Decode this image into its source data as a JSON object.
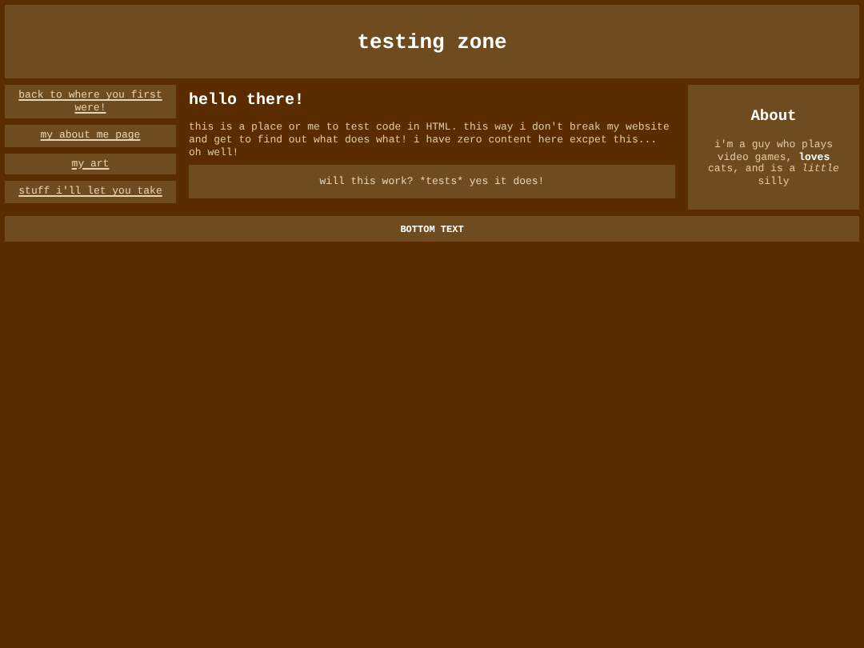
{
  "header": {
    "title": "testing zone"
  },
  "nav": [
    {
      "label": "back to where you first were!"
    },
    {
      "label": "my about me page"
    },
    {
      "label": "my art"
    },
    {
      "label": "stuff i'll let you take"
    }
  ],
  "main": {
    "heading": "hello there!",
    "paragraph": "this is a place or me to test code in HTML. this way i don't break my website and get to find out what does what! i have zero content here excpet this... oh well!",
    "box": "will this work? *tests* yes it does!"
  },
  "about": {
    "title": "About",
    "text": "i'm a guy who plays video games, **loves** cats, and is a *little* silly"
  },
  "footer": {
    "text": "BOTTOM TEXT"
  }
}
